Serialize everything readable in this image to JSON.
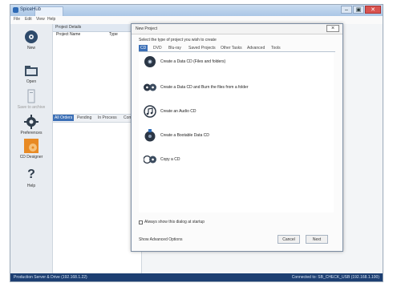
{
  "window": {
    "title": "SpiceHub",
    "controls": [
      "–",
      "▣",
      "✕"
    ]
  },
  "menu": [
    "File",
    "Edit",
    "View",
    "Help"
  ],
  "sidebar": {
    "items": [
      {
        "label": "New",
        "icon": "new-disc-icon"
      },
      {
        "label": "Open",
        "icon": "open-folder-icon"
      },
      {
        "label": "Save to archive",
        "icon": "archive-icon"
      },
      {
        "label": "Preferences",
        "icon": "gear-icon"
      },
      {
        "label": "CD Designer",
        "icon": "cd-designer-icon"
      },
      {
        "label": "Help",
        "icon": "help-icon"
      }
    ]
  },
  "project_panel": {
    "header": "Project Details",
    "columns": [
      "Project Name",
      "Type"
    ],
    "tabs": [
      "All Orders",
      "Pending",
      "In Process",
      "Complete"
    ]
  },
  "dialog": {
    "title": "New Project",
    "prompt": "Select the type of project you wish to create",
    "tabs": [
      "CD",
      "DVD",
      "Blu-ray",
      "Saved Projects",
      "Other Tasks",
      "Advanced",
      "Tools"
    ],
    "options": [
      {
        "label": "Create a Data CD (Files and folders)",
        "icon": "data-cd-icon"
      },
      {
        "label": "Create a Data CD and Burn the files from a folder",
        "icon": "multi-cd-icon"
      },
      {
        "label": "Create an Audio CD",
        "icon": "audio-cd-icon"
      },
      {
        "label": "Create a Bootable Data CD",
        "icon": "bootable-cd-icon"
      },
      {
        "label": "Copy a CD",
        "icon": "copy-cd-icon"
      }
    ],
    "checkbox_label": "Always show this dialog at startup",
    "link": "Show Advanced Options",
    "buttons": {
      "cancel": "Cancel",
      "ok": "Next"
    }
  },
  "status": {
    "left": "Production Server & Drive (192.168.1.22)",
    "right": "Connected to: SB_CHECK_USB (192.168.1.100)"
  },
  "colors": {
    "accent": "#3b6fb6",
    "status_bar": "#1d3f72",
    "titlebar": "#aac6e6"
  }
}
